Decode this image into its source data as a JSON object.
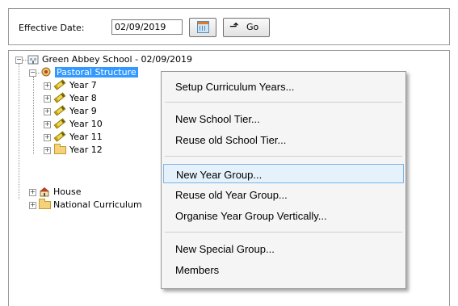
{
  "toolbar": {
    "effective_date_label": "Effective Date:",
    "effective_date_value": "02/09/2019",
    "go_label": "Go"
  },
  "tree": {
    "root": "Green Abbey School - 02/09/2019",
    "pastoral": "Pastoral Structure",
    "years": [
      "Year  7",
      "Year  8",
      "Year  9",
      "Year 10",
      "Year 11",
      "Year 12"
    ],
    "house": "House",
    "national": "National Curriculum"
  },
  "context_menu": {
    "items": [
      "Setup Curriculum Years...",
      "New School Tier...",
      "Reuse old School Tier...",
      "New Year Group...",
      "Reuse old Year Group...",
      "Organise Year Group Vertically...",
      "New Special Group...",
      "Members"
    ],
    "highlighted": "New Year Group..."
  },
  "colors": {
    "selection": "#3399ff",
    "menu_highlight": "#e5f1fb",
    "menu_highlight_border": "#7ab5e6"
  }
}
